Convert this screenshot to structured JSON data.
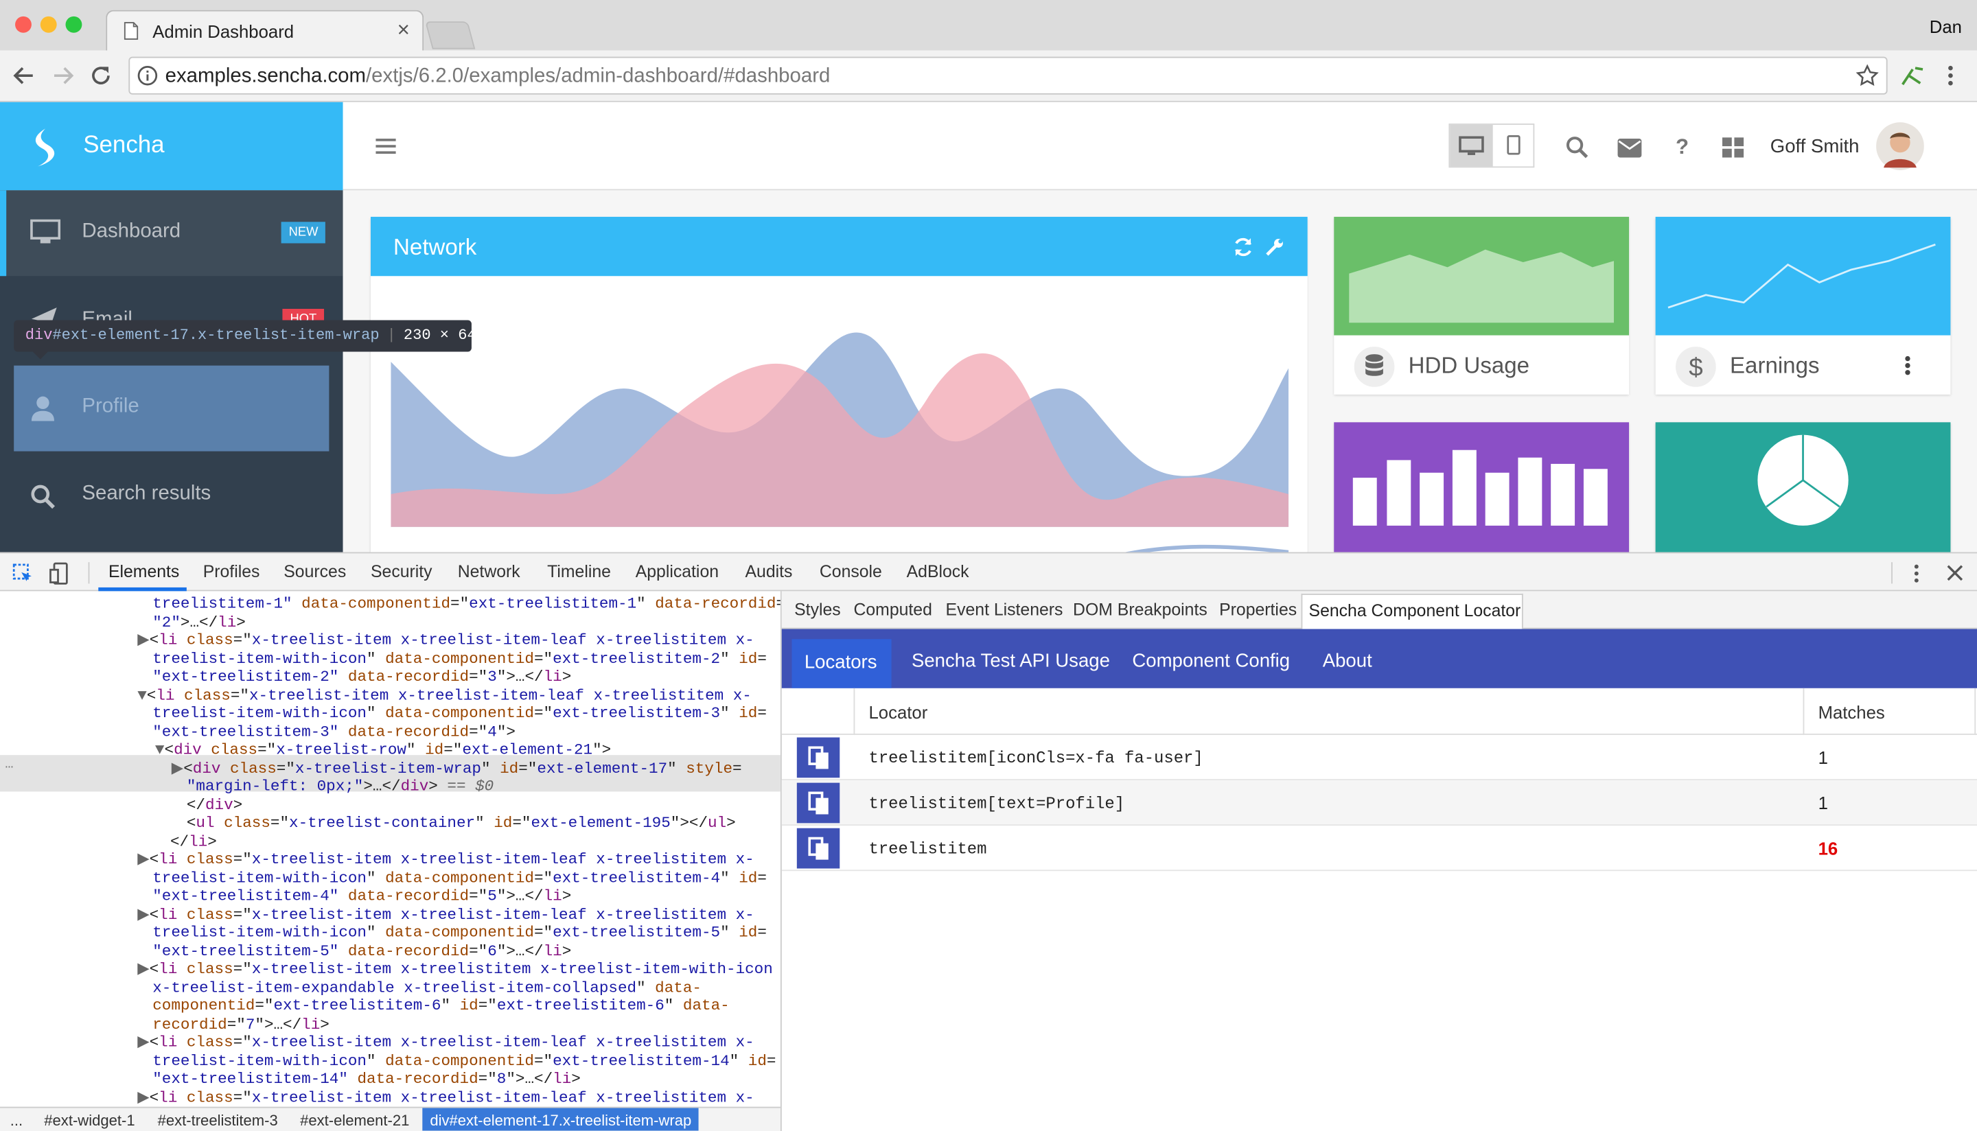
{
  "browser": {
    "tab_title": "Admin Dashboard",
    "tab_close": "×",
    "user": "Dan",
    "url_host": "examples.sencha.com",
    "url_path": "/extjs/6.2.0/examples/admin-dashboard/#dashboard"
  },
  "app": {
    "logo_text": "Sencha",
    "user_name": "Goff Smith",
    "nav": [
      {
        "label": "Dashboard",
        "badge": "NEW",
        "icon": "desktop-icon"
      },
      {
        "label": "Email",
        "badge": "HOT",
        "icon": "send-icon"
      },
      {
        "label": "Profile",
        "icon": "user-icon"
      },
      {
        "label": "Search results",
        "icon": "search-icon"
      }
    ],
    "network_title": "Network",
    "hdd_label": "HDD Usage",
    "earnings_label": "Earnings"
  },
  "tooltip": {
    "tag": "div",
    "selector": "#ext-element-17.x-treelist-item-wrap",
    "size": "230 × 64"
  },
  "devtools": {
    "tabs": [
      "Elements",
      "Profiles",
      "Sources",
      "Security",
      "Network",
      "Timeline",
      "Application",
      "Audits",
      "Console",
      "AdBlock"
    ],
    "active_tab": "Elements",
    "sub_tabs": [
      "Styles",
      "Computed",
      "Event Listeners",
      "DOM Breakpoints",
      "Properties",
      "Sencha Component Locator"
    ],
    "locator_tabs": [
      "Locators",
      "Sencha Test API Usage",
      "Component Config",
      "About"
    ],
    "col_locator": "Locator",
    "col_matches": "Matches",
    "locators": [
      {
        "text": "treelistitem[iconCls=x-fa fa-user]",
        "matches": "1"
      },
      {
        "text": "treelistitem[text=Profile]",
        "matches": "1"
      },
      {
        "text": "treelistitem",
        "matches": "16"
      }
    ],
    "breadcrumbs": [
      "...",
      "#ext-widget-1",
      "#ext-treelistitem-3",
      "#ext-element-21",
      "div#ext-element-17.x-treelist-item-wrap"
    ],
    "selected_marker": "== $0",
    "code": [
      {
        "segs": [
          [
            "v",
            "treelistitem-1\""
          ],
          [
            "t",
            " "
          ],
          [
            "a",
            "data-componentid"
          ],
          [
            "t",
            "=\""
          ],
          [
            "v",
            "ext-treelistitem-1"
          ],
          [
            "t",
            "\" "
          ],
          [
            "a",
            "data-recordid"
          ],
          [
            "t",
            "="
          ]
        ]
      },
      {
        "segs": [
          [
            "v",
            "\"2\""
          ],
          [
            "t",
            ">…</"
          ],
          [
            "g",
            "li"
          ],
          [
            "t",
            ">"
          ]
        ]
      },
      {
        "segs": [
          [
            "r",
            "▶"
          ],
          [
            "t",
            "<"
          ],
          [
            "g",
            "li"
          ],
          [
            "t",
            " "
          ],
          [
            "a",
            "class"
          ],
          [
            "t",
            "=\""
          ],
          [
            "v",
            "x-treelist-item x-treelist-item-leaf x-treelistitem x-"
          ]
        ]
      },
      {
        "segs": [
          [
            "v",
            "treelist-item-with-icon"
          ],
          [
            "t",
            "\" "
          ],
          [
            "a",
            "data-componentid"
          ],
          [
            "t",
            "=\""
          ],
          [
            "v",
            "ext-treelistitem-2"
          ],
          [
            "t",
            "\" "
          ],
          [
            "a",
            "id"
          ],
          [
            "t",
            "="
          ]
        ]
      },
      {
        "segs": [
          [
            "v",
            "\"ext-treelistitem-2\""
          ],
          [
            "t",
            " "
          ],
          [
            "a",
            "data-recordid"
          ],
          [
            "t",
            "=\""
          ],
          [
            "v",
            "3"
          ],
          [
            "t",
            "\">…</"
          ],
          [
            "g",
            "li"
          ],
          [
            "t",
            ">"
          ]
        ]
      },
      {
        "segs": [
          [
            "r",
            "▼"
          ],
          [
            "t",
            "<"
          ],
          [
            "g",
            "li"
          ],
          [
            "t",
            " "
          ],
          [
            "a",
            "class"
          ],
          [
            "t",
            "=\""
          ],
          [
            "v",
            "x-treelist-item x-treelist-item-leaf x-treelistitem x-"
          ]
        ]
      },
      {
        "segs": [
          [
            "v",
            "treelist-item-with-icon"
          ],
          [
            "t",
            "\" "
          ],
          [
            "a",
            "data-componentid"
          ],
          [
            "t",
            "=\""
          ],
          [
            "v",
            "ext-treelistitem-3"
          ],
          [
            "t",
            "\" "
          ],
          [
            "a",
            "id"
          ],
          [
            "t",
            "="
          ]
        ]
      },
      {
        "segs": [
          [
            "v",
            "\"ext-treelistitem-3\""
          ],
          [
            "t",
            " "
          ],
          [
            "a",
            "data-recordid"
          ],
          [
            "t",
            "=\""
          ],
          [
            "v",
            "4"
          ],
          [
            "t",
            "\">"
          ]
        ]
      },
      {
        "segs": [
          [
            "r",
            "▼"
          ],
          [
            "t",
            "<"
          ],
          [
            "g",
            "div"
          ],
          [
            "t",
            " "
          ],
          [
            "a",
            "class"
          ],
          [
            "t",
            "=\""
          ],
          [
            "v",
            "x-treelist-row"
          ],
          [
            "t",
            "\" "
          ],
          [
            "a",
            "id"
          ],
          [
            "t",
            "=\""
          ],
          [
            "v",
            "ext-element-21"
          ],
          [
            "t",
            "\">"
          ]
        ]
      },
      {
        "segs": [
          [
            "r",
            "▶"
          ],
          [
            "t",
            "<"
          ],
          [
            "g",
            "div"
          ],
          [
            "t",
            " "
          ],
          [
            "a",
            "class"
          ],
          [
            "t",
            "=\""
          ],
          [
            "v",
            "x-treelist-item-wrap"
          ],
          [
            "t",
            "\" "
          ],
          [
            "a",
            "id"
          ],
          [
            "t",
            "=\""
          ],
          [
            "v",
            "ext-element-17"
          ],
          [
            "t",
            "\" "
          ],
          [
            "a",
            "style"
          ],
          [
            "t",
            "="
          ]
        ]
      },
      {
        "segs": [
          [
            "v",
            "\"margin-left: 0px;\""
          ],
          [
            "t",
            ">…</"
          ],
          [
            "g",
            "div"
          ],
          [
            "t",
            ">"
          ],
          [
            "i",
            " == $0"
          ]
        ]
      },
      {
        "segs": [
          [
            "t",
            "</"
          ],
          [
            "g",
            "div"
          ],
          [
            "t",
            ">"
          ]
        ]
      },
      {
        "segs": [
          [
            "t",
            "<"
          ],
          [
            "g",
            "ul"
          ],
          [
            "t",
            " "
          ],
          [
            "a",
            "class"
          ],
          [
            "t",
            "=\""
          ],
          [
            "v",
            "x-treelist-container"
          ],
          [
            "t",
            "\" "
          ],
          [
            "a",
            "id"
          ],
          [
            "t",
            "=\""
          ],
          [
            "v",
            "ext-element-195"
          ],
          [
            "t",
            "\"></"
          ],
          [
            "g",
            "ul"
          ],
          [
            "t",
            ">"
          ]
        ]
      },
      {
        "segs": [
          [
            "t",
            "</"
          ],
          [
            "g",
            "li"
          ],
          [
            "t",
            ">"
          ]
        ]
      },
      {
        "segs": [
          [
            "r",
            "▶"
          ],
          [
            "t",
            "<"
          ],
          [
            "g",
            "li"
          ],
          [
            "t",
            " "
          ],
          [
            "a",
            "class"
          ],
          [
            "t",
            "=\""
          ],
          [
            "v",
            "x-treelist-item x-treelist-item-leaf x-treelistitem x-"
          ]
        ]
      },
      {
        "segs": [
          [
            "v",
            "treelist-item-with-icon"
          ],
          [
            "t",
            "\" "
          ],
          [
            "a",
            "data-componentid"
          ],
          [
            "t",
            "=\""
          ],
          [
            "v",
            "ext-treelistitem-4"
          ],
          [
            "t",
            "\" "
          ],
          [
            "a",
            "id"
          ],
          [
            "t",
            "="
          ]
        ]
      },
      {
        "segs": [
          [
            "v",
            "\"ext-treelistitem-4\""
          ],
          [
            "t",
            " "
          ],
          [
            "a",
            "data-recordid"
          ],
          [
            "t",
            "=\""
          ],
          [
            "v",
            "5"
          ],
          [
            "t",
            "\">…</"
          ],
          [
            "g",
            "li"
          ],
          [
            "t",
            ">"
          ]
        ]
      },
      {
        "segs": [
          [
            "r",
            "▶"
          ],
          [
            "t",
            "<"
          ],
          [
            "g",
            "li"
          ],
          [
            "t",
            " "
          ],
          [
            "a",
            "class"
          ],
          [
            "t",
            "=\""
          ],
          [
            "v",
            "x-treelist-item x-treelist-item-leaf x-treelistitem x-"
          ]
        ]
      },
      {
        "segs": [
          [
            "v",
            "treelist-item-with-icon"
          ],
          [
            "t",
            "\" "
          ],
          [
            "a",
            "data-componentid"
          ],
          [
            "t",
            "=\""
          ],
          [
            "v",
            "ext-treelistitem-5"
          ],
          [
            "t",
            "\" "
          ],
          [
            "a",
            "id"
          ],
          [
            "t",
            "="
          ]
        ]
      },
      {
        "segs": [
          [
            "v",
            "\"ext-treelistitem-5\""
          ],
          [
            "t",
            " "
          ],
          [
            "a",
            "data-recordid"
          ],
          [
            "t",
            "=\""
          ],
          [
            "v",
            "6"
          ],
          [
            "t",
            "\">…</"
          ],
          [
            "g",
            "li"
          ],
          [
            "t",
            ">"
          ]
        ]
      },
      {
        "segs": [
          [
            "r",
            "▶"
          ],
          [
            "t",
            "<"
          ],
          [
            "g",
            "li"
          ],
          [
            "t",
            " "
          ],
          [
            "a",
            "class"
          ],
          [
            "t",
            "=\""
          ],
          [
            "v",
            "x-treelist-item x-treelistitem x-treelist-item-with-icon"
          ]
        ]
      },
      {
        "segs": [
          [
            "v",
            "x-treelist-item-expandable x-treelist-item-collapsed"
          ],
          [
            "t",
            "\" "
          ],
          [
            "a",
            "data-"
          ]
        ]
      },
      {
        "segs": [
          [
            "a",
            "componentid"
          ],
          [
            "t",
            "=\""
          ],
          [
            "v",
            "ext-treelistitem-6"
          ],
          [
            "t",
            "\" "
          ],
          [
            "a",
            "id"
          ],
          [
            "t",
            "=\""
          ],
          [
            "v",
            "ext-treelistitem-6"
          ],
          [
            "t",
            "\" "
          ],
          [
            "a",
            "data-"
          ]
        ]
      },
      {
        "segs": [
          [
            "a",
            "recordid"
          ],
          [
            "t",
            "=\""
          ],
          [
            "v",
            "7"
          ],
          [
            "t",
            "\">…</"
          ],
          [
            "g",
            "li"
          ],
          [
            "t",
            ">"
          ]
        ]
      },
      {
        "segs": [
          [
            "r",
            "▶"
          ],
          [
            "t",
            "<"
          ],
          [
            "g",
            "li"
          ],
          [
            "t",
            " "
          ],
          [
            "a",
            "class"
          ],
          [
            "t",
            "=\""
          ],
          [
            "v",
            "x-treelist-item x-treelist-item-leaf x-treelistitem x-"
          ]
        ]
      },
      {
        "segs": [
          [
            "v",
            "treelist-item-with-icon"
          ],
          [
            "t",
            "\" "
          ],
          [
            "a",
            "data-componentid"
          ],
          [
            "t",
            "=\""
          ],
          [
            "v",
            "ext-treelistitem-14"
          ],
          [
            "t",
            "\" "
          ],
          [
            "a",
            "id"
          ],
          [
            "t",
            "="
          ]
        ]
      },
      {
        "segs": [
          [
            "v",
            "\"ext-treelistitem-14\""
          ],
          [
            "t",
            " "
          ],
          [
            "a",
            "data-recordid"
          ],
          [
            "t",
            "=\""
          ],
          [
            "v",
            "8"
          ],
          [
            "t",
            "\">…</"
          ],
          [
            "g",
            "li"
          ],
          [
            "t",
            ">"
          ]
        ]
      },
      {
        "segs": [
          [
            "r",
            "▶"
          ],
          [
            "t",
            "<"
          ],
          [
            "g",
            "li"
          ],
          [
            "t",
            " "
          ],
          [
            "a",
            "class"
          ],
          [
            "t",
            "=\""
          ],
          [
            "v",
            "x-treelist-item x-treelist-item-leaf x-treelistitem x-"
          ]
        ]
      }
    ]
  },
  "colors": {
    "brand": "#35baf6",
    "nav_bg": "#32404e",
    "locator_bar": "#3f51b5",
    "hdd": "#6abf69",
    "earnings": "#35baf6",
    "purple": "#8b4fc6",
    "teal": "#26a69a",
    "badge_new": "#35a3dc",
    "badge_hot": "#e9414f",
    "match_hot": "#e00000"
  }
}
